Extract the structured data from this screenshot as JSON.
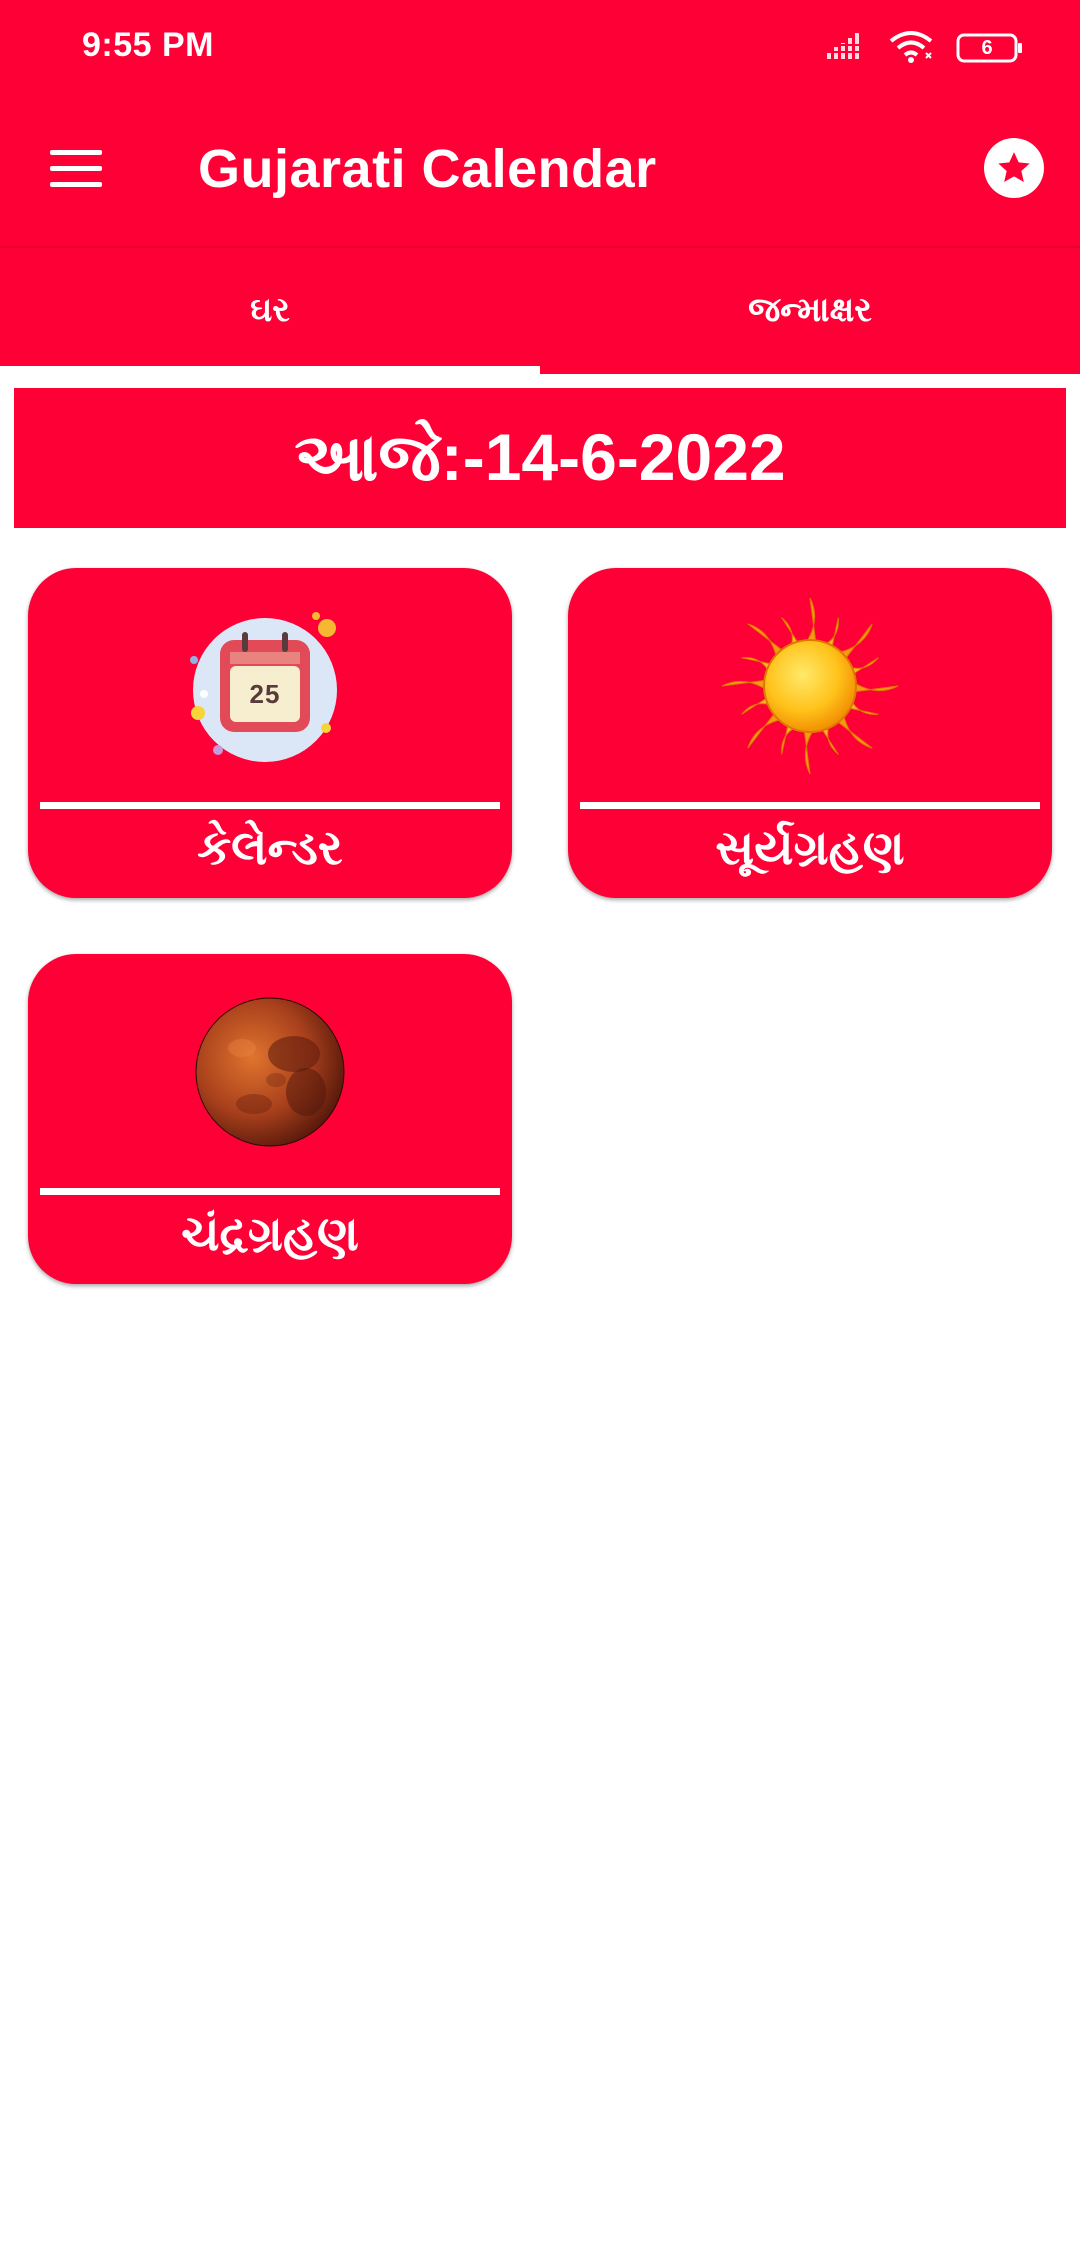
{
  "status_bar": {
    "time": "9:55 PM",
    "battery_level": "6"
  },
  "toolbar": {
    "title": "Gujarati Calendar",
    "menu_icon": "hamburger-menu-icon",
    "favorite_icon": "star-icon"
  },
  "tabs": [
    {
      "label": "ઘર",
      "selected": true
    },
    {
      "label": "જન્માક્ષર",
      "selected": false
    }
  ],
  "date_banner": {
    "text": "આજે:-14-6-2022"
  },
  "tiles": [
    {
      "label": "કેલેન્ડર",
      "icon": "calendar-icon",
      "calendar_day": "25"
    },
    {
      "label": "સૂર્યગ્રહણ",
      "icon": "sun-icon"
    },
    {
      "label": "ચંદ્રગ્રહણ",
      "icon": "blood-moon-icon"
    }
  ],
  "colors": {
    "primary": "#ff0036",
    "on_primary": "#ffffff",
    "background": "#ffffff"
  }
}
